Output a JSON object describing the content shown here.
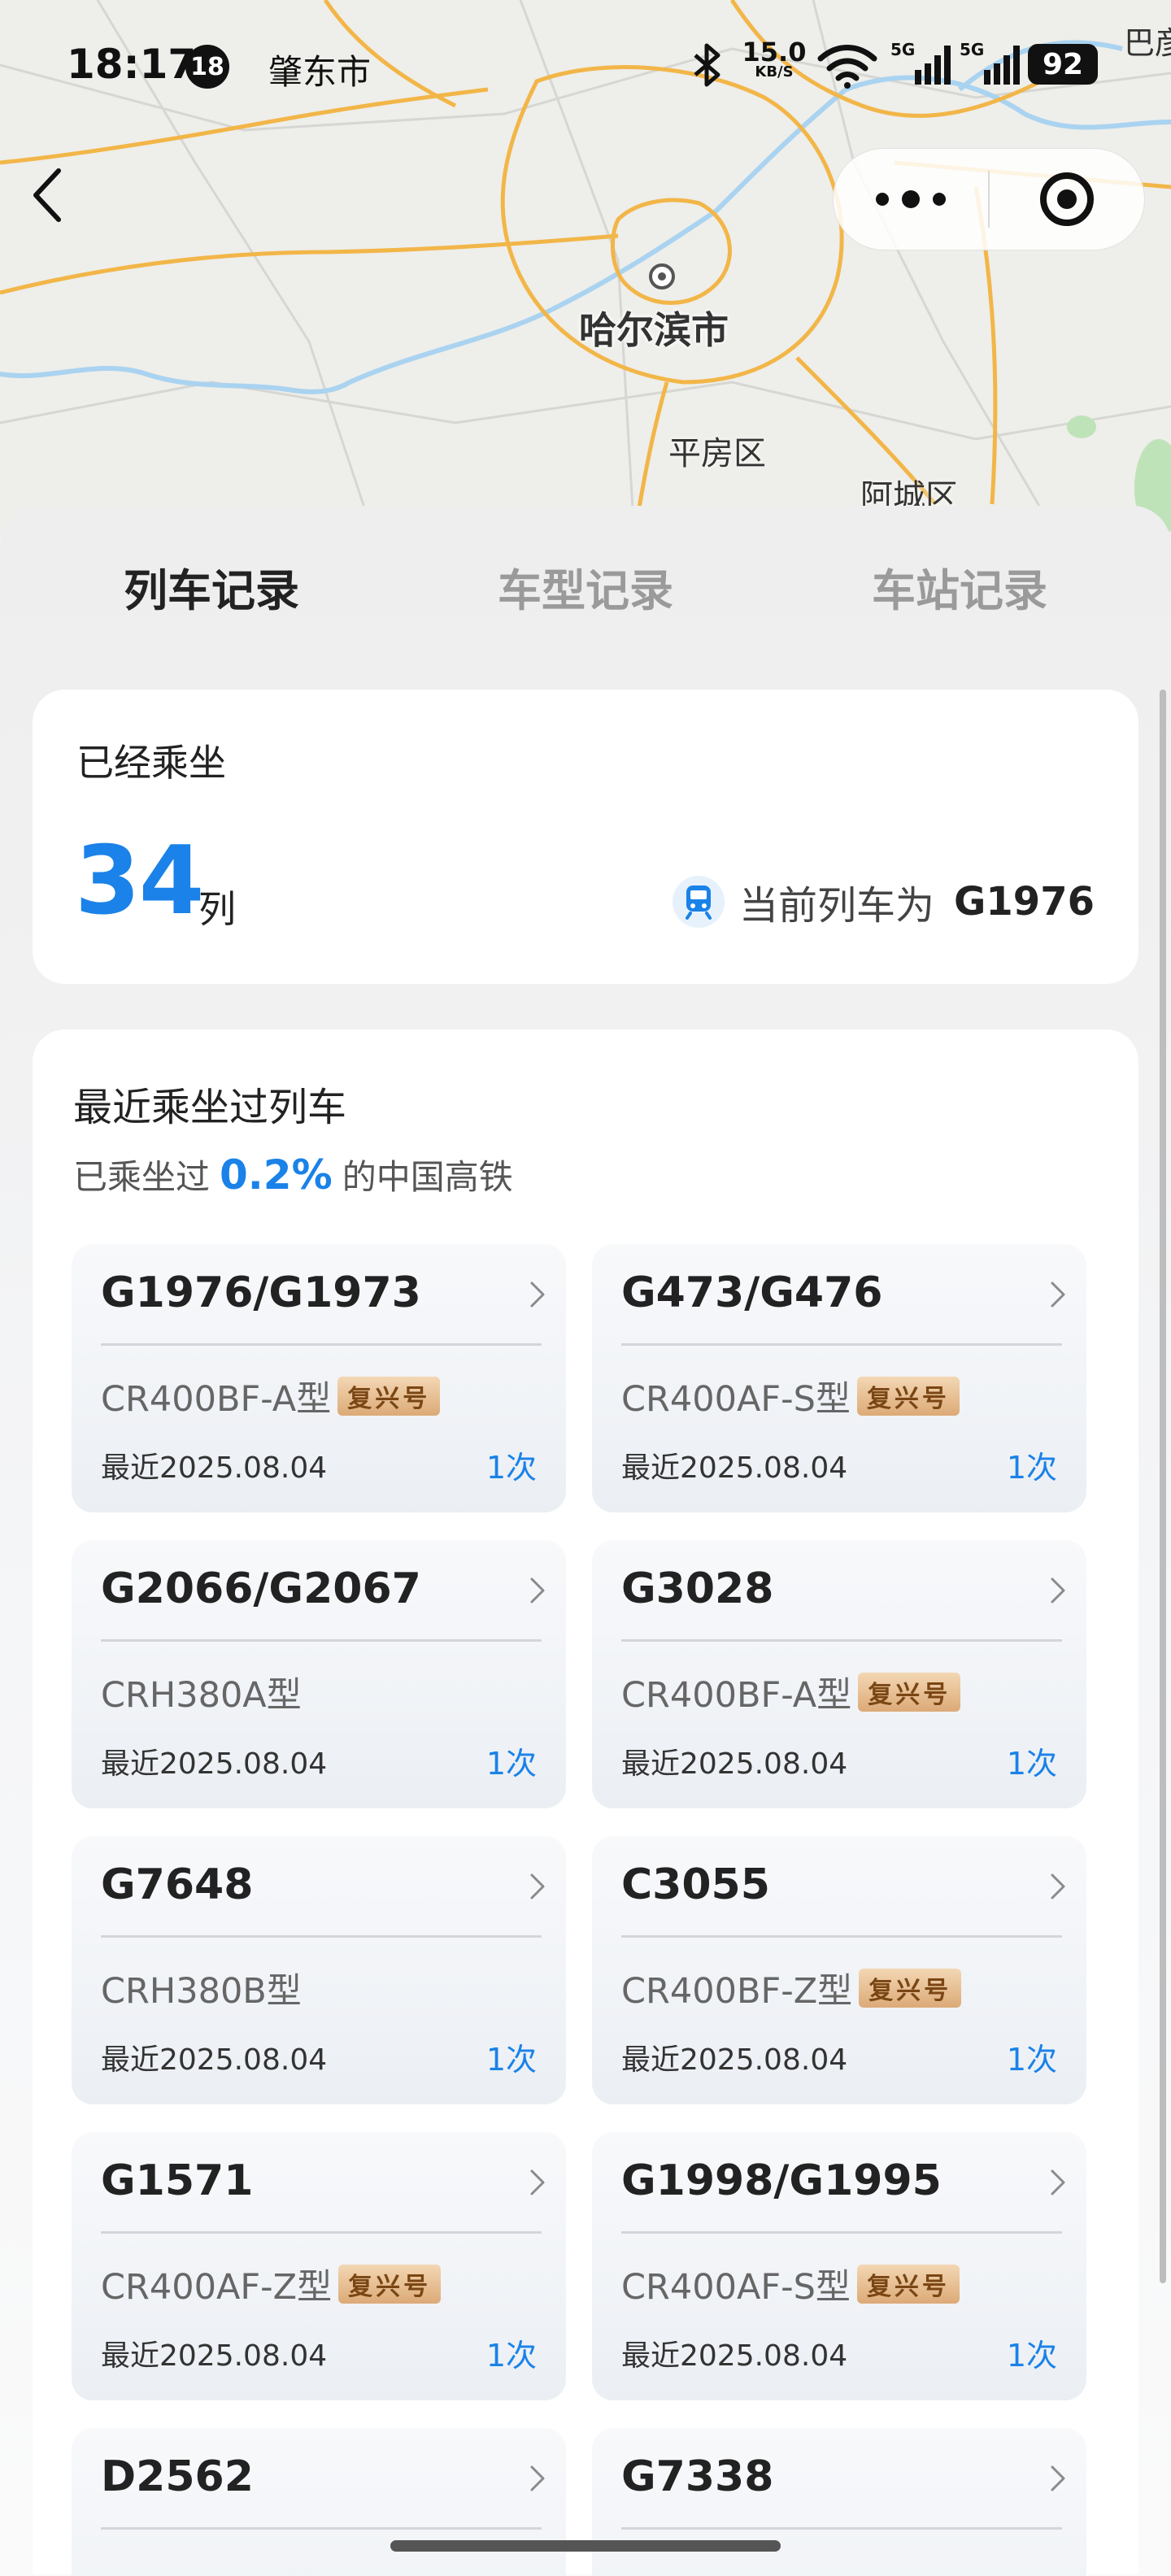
{
  "status_bar": {
    "time": "18:17",
    "notif_count": "18",
    "city": "肇东市",
    "net_speed": "15.0",
    "net_unit": "KB/S",
    "battery": "92"
  },
  "map": {
    "city_label": "哈尔滨市",
    "district_1": "平房区",
    "district_2": "阿城区",
    "district_3": "巴彦"
  },
  "tabs": [
    {
      "label": "列车记录",
      "active": true
    },
    {
      "label": "车型记录",
      "active": false
    },
    {
      "label": "车站记录",
      "active": false
    }
  ],
  "summary": {
    "title": "已经乘坐",
    "count": "34",
    "unit": "列",
    "current_label": "当前列车为",
    "current_value": "G1976"
  },
  "recent": {
    "title": "最近乘坐过列车",
    "sub_prefix": "已乘坐过",
    "sub_pct": "0.2%",
    "sub_suffix": "的中国高铁",
    "fuxing_label": "复兴号",
    "trains": [
      {
        "no": "G1976/G1973",
        "model": "CR400BF-A型",
        "fuxing": true,
        "date": "最近2025.08.04",
        "count": "1次"
      },
      {
        "no": "G473/G476",
        "model": "CR400AF-S型",
        "fuxing": true,
        "date": "最近2025.08.04",
        "count": "1次"
      },
      {
        "no": "G2066/G2067",
        "model": "CRH380A型",
        "fuxing": false,
        "date": "最近2025.08.04",
        "count": "1次"
      },
      {
        "no": "G3028",
        "model": "CR400BF-A型",
        "fuxing": true,
        "date": "最近2025.08.04",
        "count": "1次"
      },
      {
        "no": "G7648",
        "model": "CRH380B型",
        "fuxing": false,
        "date": "最近2025.08.04",
        "count": "1次"
      },
      {
        "no": "C3055",
        "model": "CR400BF-Z型",
        "fuxing": true,
        "date": "最近2025.08.04",
        "count": "1次"
      },
      {
        "no": "G1571",
        "model": "CR400AF-Z型",
        "fuxing": true,
        "date": "最近2025.08.04",
        "count": "1次"
      },
      {
        "no": "G1998/G1995",
        "model": "CR400AF-S型",
        "fuxing": true,
        "date": "最近2025.08.04",
        "count": "1次"
      },
      {
        "no": "D2562",
        "model": "",
        "fuxing": false,
        "date": "",
        "count": ""
      },
      {
        "no": "G7338",
        "model": "",
        "fuxing": false,
        "date": "",
        "count": ""
      }
    ]
  },
  "colors": {
    "accent": "#1a82e8",
    "fuxing_badge": "#dcaa77"
  }
}
